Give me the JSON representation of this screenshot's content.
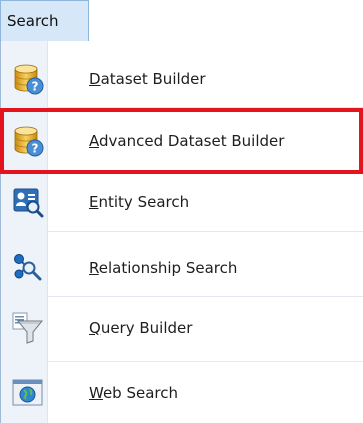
{
  "menu": {
    "title": "Search"
  },
  "items": [
    {
      "label_first": "D",
      "label_rest": "ataset Builder",
      "icon": "database-help-icon"
    },
    {
      "label_first": "A",
      "label_rest": "dvanced Dataset Builder",
      "icon": "database-help-icon"
    },
    {
      "label_first": "E",
      "label_rest": "ntity Search",
      "icon": "entity-search-icon"
    },
    {
      "label_first": "R",
      "label_rest": "elationship Search",
      "icon": "relationship-search-icon"
    },
    {
      "label_first": "Q",
      "label_rest": "uery Builder",
      "icon": "funnel-icon"
    },
    {
      "label_first": "W",
      "label_rest": "eb Search",
      "icon": "globe-icon"
    }
  ],
  "highlighted_item": "Advanced Dataset Builder",
  "colors": {
    "highlight": "#e3141d",
    "menu_title_bg": "#d6e8f8",
    "icon_column_bg": "#eef3fa"
  }
}
